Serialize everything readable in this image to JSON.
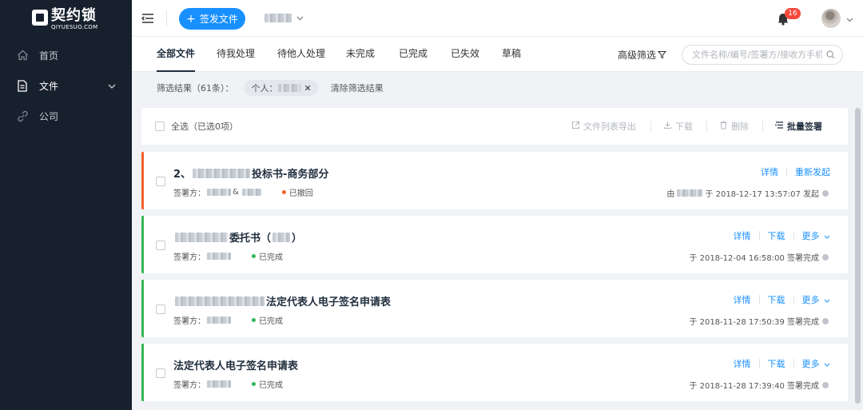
{
  "sidebar": {
    "logo_cn": "契约锁",
    "logo_en": "QIYUESUO.COM",
    "items": [
      {
        "label": "首页",
        "icon": "home-icon"
      },
      {
        "label": "文件",
        "icon": "document-icon"
      },
      {
        "label": "公司",
        "icon": "link-icon"
      }
    ]
  },
  "header": {
    "send_label": "签发文件",
    "notification_count": "16"
  },
  "tabs": [
    "全部文件",
    "待我处理",
    "待他人处理",
    "未完成",
    "已完成",
    "已失效",
    "草稿"
  ],
  "advanced_filter": "高级筛选",
  "search": {
    "placeholder": "文件名称/编号/签署方/接收方手机号"
  },
  "filter": {
    "result": "筛选结果（61条）：",
    "chip_label": "个人：",
    "clear": "清除筛选结果"
  },
  "toolbar": {
    "select_all": "全选（已选0项）",
    "export": "文件列表导出",
    "download": "下载",
    "delete": "删除",
    "batch_sign": "批量签署"
  },
  "documents": [
    {
      "title_prefix": "2、",
      "title_suffix": "投标书-商务部分",
      "signer_label": "签署方：",
      "signer_join": "&",
      "status": "已撤回",
      "status_color": "#f5602c",
      "accent_color": "#f5602c",
      "actions": [
        "详情",
        "重新发起"
      ],
      "info_prefix": "由",
      "info_time": "于 2018-12-17 13:57:07 发起"
    },
    {
      "title_prefix": "",
      "title_suffix": "委托书（",
      "title_tail": "）",
      "signer_label": "签署方：",
      "status": "已完成",
      "status_color": "#35b558",
      "accent_color": "#35b558",
      "actions": [
        "详情",
        "下载",
        "更多"
      ],
      "info_time": "于 2018-12-04 16:58:00 签署完成"
    },
    {
      "title_prefix": "",
      "title_suffix": "法定代表人电子签名申请表",
      "signer_label": "签署方：",
      "status": "已完成",
      "status_color": "#35b558",
      "accent_color": "#35b558",
      "actions": [
        "详情",
        "下载",
        "更多"
      ],
      "info_time": "于 2018-11-28 17:50:39 签署完成"
    },
    {
      "title_prefix": "",
      "title_suffix": "法定代表人电子签名申请表",
      "signer_label": "签署方：",
      "status": "已完成",
      "status_color": "#35b558",
      "accent_color": "#35b558",
      "actions": [
        "详情",
        "下载",
        "更多"
      ],
      "info_time": "于 2018-11-28 17:39:40 签署完成"
    }
  ]
}
